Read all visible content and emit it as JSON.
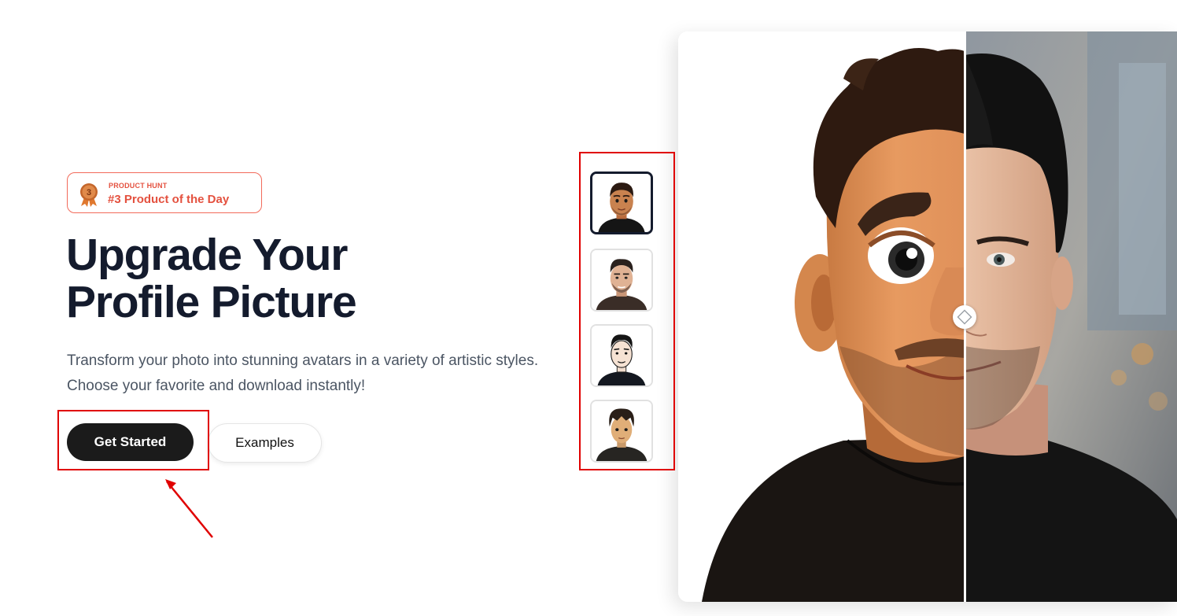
{
  "badge": {
    "kicker": "PRODUCT HUNT",
    "title": "#3 Product of the Day",
    "medal_number": "3",
    "icon": "medal-icon",
    "color": "#e4513f"
  },
  "hero": {
    "headline_line1": "Upgrade Your",
    "headline_line2": "Profile Picture",
    "subheadline": "Transform your photo into stunning avatars in a variety of artistic styles. Choose your favorite and download instantly!"
  },
  "actions": {
    "primary_label": "Get Started",
    "secondary_label": "Examples"
  },
  "styles": {
    "items": [
      {
        "name": "3d-cartoon",
        "selected": true
      },
      {
        "name": "illustrated",
        "selected": false
      },
      {
        "name": "line-art",
        "selected": false
      },
      {
        "name": "anime",
        "selected": false
      }
    ]
  },
  "compare": {
    "left": "3d-cartoon-avatar",
    "right": "original-photo",
    "handle_icon": "diamond-handle-icon"
  },
  "colors": {
    "accent": "#e4513f",
    "heading": "#141b2d",
    "annotation": "#e00000"
  }
}
